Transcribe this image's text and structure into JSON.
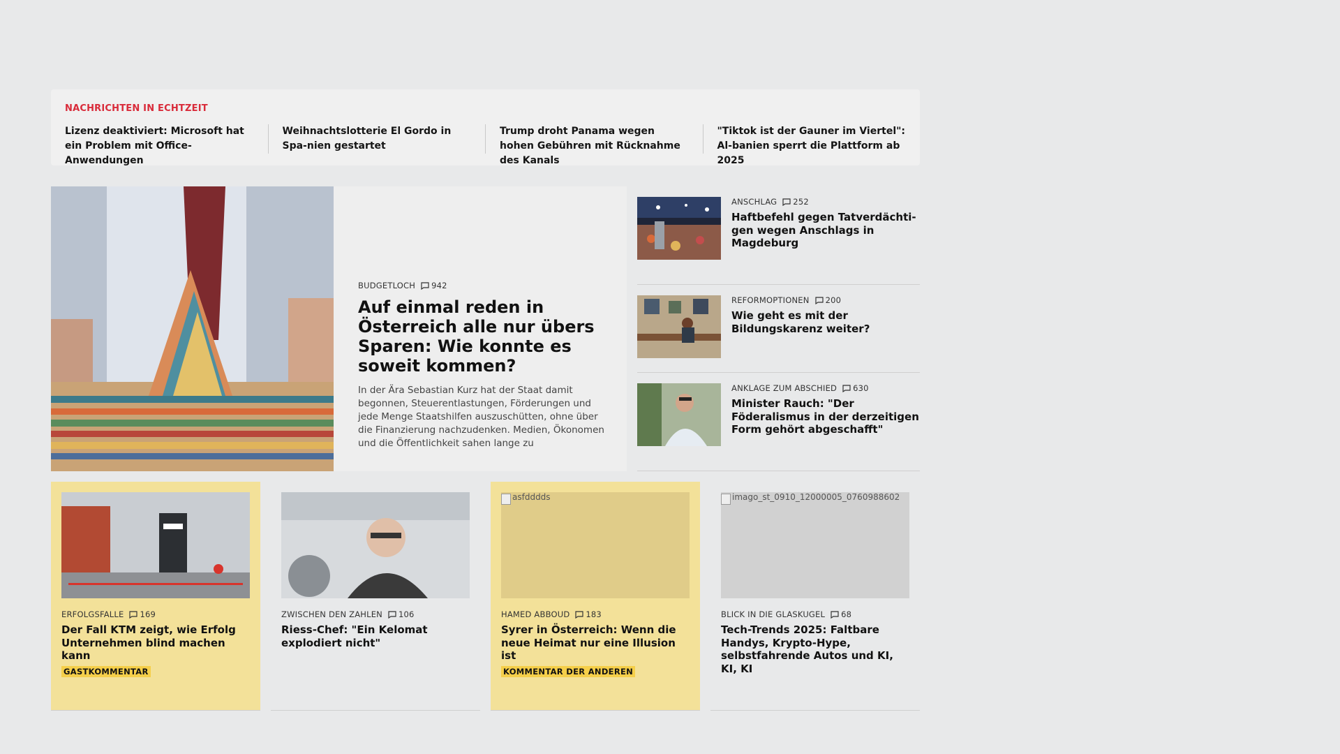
{
  "ticker": {
    "label": "NACHRICHTEN IN ECHTZEIT",
    "items": [
      "Lizenz deaktiviert: Microsoft hat ein Problem mit Office-Anwendungen",
      "Weihnachtslotterie El Gordo in Spa-nien gestartet",
      "Trump droht Panama wegen hohen Gebühren mit Rücknahme des Kanals",
      "\"Tiktok ist der Gauner im Viertel\": Al-banien sperrt die Plattform ab 2025"
    ]
  },
  "lead": {
    "kicker": "BUDGETLOCH",
    "comments": "942",
    "title": "Auf einmal reden in Österreich alle nur übers Sparen: Wie konnte es soweit kommen?",
    "teaser": "In der Ära Sebastian Kurz hat der Staat damit begonnen, Steuerentlastungen, Förderungen und jede Menge Staatshilfen auszuschütten, ohne über die Finanzierung nachzudenken. Medien, Ökonomen und die Öffentlichkeit sahen lange zu"
  },
  "side": [
    {
      "kicker": "ANSCHLAG",
      "comments": "252",
      "title": "Haftbefehl gegen Tatverdächti-gen wegen Anschlags in Magdeburg"
    },
    {
      "kicker": "REFORMOPTIONEN",
      "comments": "200",
      "title": "Wie geht es mit der Bildungskarenz weiter?"
    },
    {
      "kicker": "ANKLAGE ZUM ABSCHIED",
      "comments": "630",
      "title": "Minister Rauch: \"Der Föderalismus in der derzeitigen Form gehört abgeschafft\""
    }
  ],
  "cards": [
    {
      "kicker": "ERFOLGSFALLE",
      "comments": "169",
      "title": "Der Fall KTM zeigt, wie Erfolg Unternehmen blind machen kann",
      "tag": "GASTKOMMENTAR",
      "img_alt": ""
    },
    {
      "kicker": "ZWISCHEN DEN ZAHLEN",
      "comments": "106",
      "title": "Riess-Chef: \"Ein Kelomat explodiert nicht\"",
      "tag": "",
      "img_alt": ""
    },
    {
      "kicker": "HAMED ABBOUD",
      "comments": "183",
      "title": "Syrer in Österreich: Wenn die neue Heimat nur eine Illusion ist",
      "tag": "KOMMENTAR DER ANDEREN",
      "img_alt": "asfdddds"
    },
    {
      "kicker": "BLICK IN DIE GLASKUGEL",
      "comments": "68",
      "title": "Tech-Trends 2025: Faltbare Handys, Krypto-Hype, selbstfahrende Autos und KI, KI, KI",
      "tag": "",
      "img_alt": "imago_st_0910_12000005_0760988602"
    }
  ],
  "colors": {
    "accent_red": "#d92b3a",
    "card_yellow": "#f3e199",
    "tag_yellow": "#f5cf4a"
  },
  "icons": {
    "comment": "comment-bubble-icon"
  }
}
